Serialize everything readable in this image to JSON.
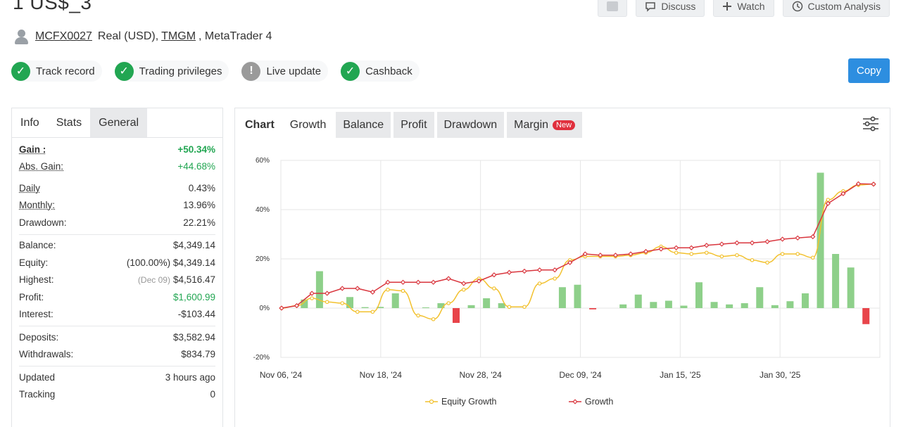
{
  "header": {
    "title": "1 US$_3",
    "actions": [
      {
        "label": ""
      },
      {
        "label": "Discuss",
        "icon": "comment-icon"
      },
      {
        "label": "Watch",
        "icon": "plus-icon"
      },
      {
        "label": "Custom Analysis",
        "icon": "clock-icon"
      }
    ]
  },
  "owner": {
    "username": "MCFX0027",
    "account_type": "Real (USD),",
    "broker": "TMGM",
    "platform": ", MetaTrader 4"
  },
  "badges": [
    {
      "label": "Track record",
      "status": "ok"
    },
    {
      "label": "Trading privileges",
      "status": "ok"
    },
    {
      "label": "Live update",
      "status": "warn"
    },
    {
      "label": "Cashback",
      "status": "ok"
    }
  ],
  "copy_button": "Copy",
  "left_tabs": [
    "Info",
    "Stats",
    "General"
  ],
  "stats": {
    "gain_label": "Gain :",
    "gain": "+50.34%",
    "abs_gain_label": "Abs. Gain:",
    "abs_gain": "+44.68%",
    "daily_label": "Daily",
    "daily": "0.43%",
    "monthly_label": "Monthly:",
    "monthly": "13.96%",
    "drawdown_label": "Drawdown:",
    "drawdown": "22.21%",
    "balance_label": "Balance:",
    "balance": "$4,349.14",
    "equity_label": "Equity:",
    "equity": "(100.00%) $4,349.14",
    "highest_label": "Highest:",
    "highest_date": "(Dec 09)",
    "highest": "$4,516.47",
    "profit_label": "Profit:",
    "profit": "$1,600.99",
    "interest_label": "Interest:",
    "interest": "-$103.44",
    "deposits_label": "Deposits:",
    "deposits": "$3,582.94",
    "withdrawals_label": "Withdrawals:",
    "withdrawals": "$834.79",
    "updated_label": "Updated",
    "updated": "3 hours ago",
    "tracking_label": "Tracking",
    "tracking": "0"
  },
  "chart_tabs": {
    "label": "Chart",
    "items": [
      "Growth",
      "Balance",
      "Profit",
      "Drawdown",
      "Margin"
    ],
    "new_badge": "New"
  },
  "colors": {
    "equity": "#f2c12e",
    "growth": "#d9363e",
    "bar_pos": "#8ed08a",
    "bar_neg": "#e8444a",
    "accent": "#2d8ee0",
    "ok": "#22a652"
  },
  "chart_data": {
    "type": "line",
    "y_ticks": [
      "60%",
      "40%",
      "20%",
      "0%",
      "-20%"
    ],
    "ylim": [
      -20,
      60
    ],
    "x_ticks": [
      "Nov 06, '24",
      "Nov 18, '24",
      "Nov 28, '24",
      "Dec 09, '24",
      "Jan 15, '25",
      "Jan 30, '25"
    ],
    "grid": true,
    "legend": "bottom",
    "series": [
      {
        "name": "Equity Growth",
        "values": [
          0,
          1,
          4,
          2.5,
          2,
          -1.5,
          -1.5,
          7.5,
          7,
          -3,
          -4.5,
          2,
          7.5,
          12,
          8,
          0.5,
          0.5,
          10,
          12,
          19.5,
          21,
          21,
          21,
          21.5,
          22.5,
          25,
          22.5,
          22,
          22.5,
          21,
          21.5,
          19.5,
          18.5,
          22,
          22,
          20.5,
          44,
          47.5,
          50,
          50.34
        ]
      },
      {
        "name": "Growth",
        "values": [
          0,
          1,
          6,
          6,
          8,
          8,
          6.5,
          10.5,
          10.5,
          10.5,
          10.5,
          12,
          10,
          11,
          13.5,
          14.5,
          15,
          15.5,
          15.5,
          18.5,
          22,
          21.5,
          21.5,
          22,
          23,
          24,
          24.5,
          24.5,
          25.5,
          26,
          26.5,
          26.5,
          27,
          28,
          28.5,
          29,
          42.5,
          46.5,
          50.5,
          50.34
        ]
      }
    ],
    "bars": [
      0,
      3.5,
      15,
      0,
      4.5,
      0.4,
      0.5,
      6,
      0,
      0.3,
      2,
      -6,
      1.2,
      4,
      2,
      0,
      0,
      0,
      8.5,
      9.5,
      -0.5,
      0,
      1.5,
      5.5,
      2.5,
      3,
      1,
      10.5,
      2.5,
      1.5,
      2,
      8.5,
      1.2,
      2.8,
      6,
      55,
      22,
      16.5,
      -6.5
    ]
  }
}
